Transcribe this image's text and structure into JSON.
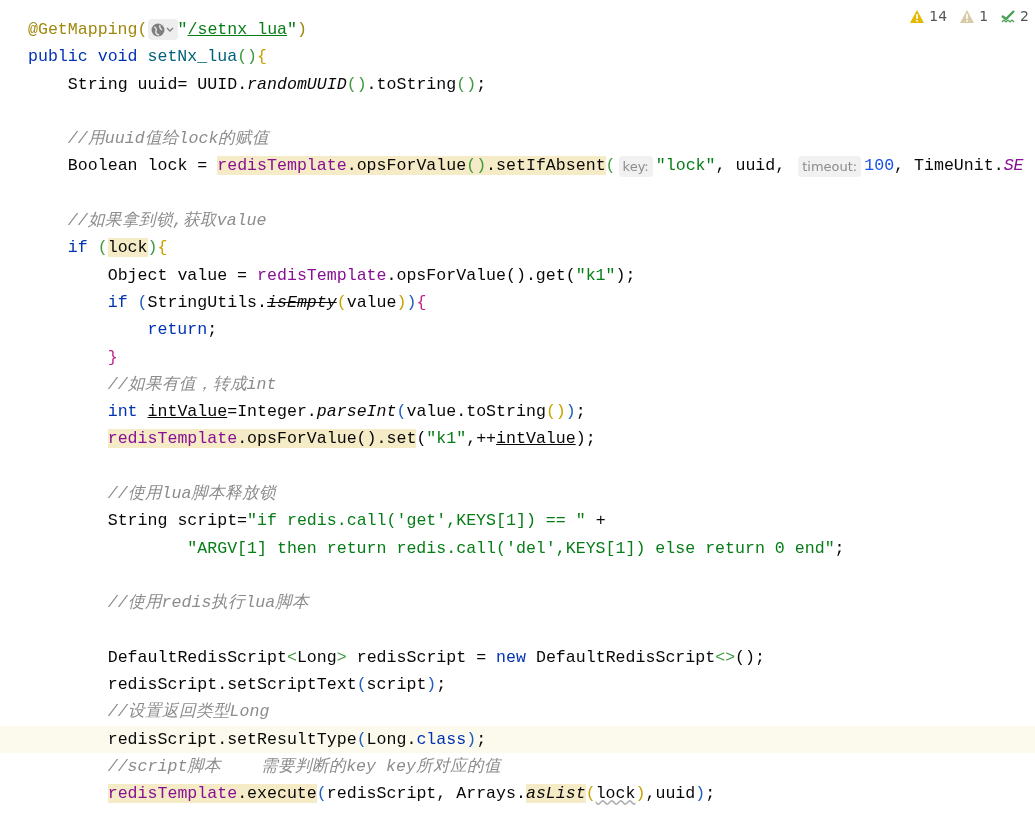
{
  "inspections": [
    {
      "kind": "warning",
      "count": "14"
    },
    {
      "kind": "weak_warning",
      "count": "1"
    },
    {
      "kind": "typo",
      "count": "2"
    }
  ],
  "lines": [
    {
      "current": false,
      "segments": [
        {
          "kind": "code",
          "tokens": [
            {
              "text": "@GetMapping(",
              "kind": "ann"
            }
          ]
        },
        {
          "kind": "icon"
        },
        {
          "kind": "code",
          "tokens": [
            {
              "text": "\"",
              "kind": "str"
            },
            {
              "text": "/setnx_lua",
              "kind": "str",
              "underlined": true
            },
            {
              "text": "\"",
              "kind": "str"
            },
            {
              "text": ")",
              "kind": "ann"
            }
          ]
        }
      ]
    },
    {
      "current": false,
      "segments": [
        {
          "kind": "code",
          "tokens": [
            {
              "text": "public void ",
              "kind": "kw"
            },
            {
              "text": "setNx_lua",
              "kind": "decl"
            },
            {
              "text": "()",
              "kind": "g"
            },
            {
              "text": "{",
              "kind": "y"
            }
          ]
        }
      ]
    },
    {
      "current": false,
      "segments": [
        {
          "kind": "code",
          "tokens": [
            {
              "text": "    String uuid= UUID.",
              "kind": "t"
            },
            {
              "text": "randomUUID",
              "kind": "it"
            },
            {
              "text": "()",
              "kind": "g"
            },
            {
              "text": ".toString",
              "kind": "t"
            },
            {
              "text": "()",
              "kind": "g"
            },
            {
              "text": ";",
              "kind": "t"
            }
          ]
        }
      ]
    },
    {
      "current": false
    },
    {
      "current": false,
      "segments": [
        {
          "kind": "code",
          "tokens": [
            {
              "text": "    //用uuid值给lock的赋值",
              "kind": "cm"
            }
          ]
        }
      ]
    },
    {
      "current": false,
      "segments": [
        {
          "kind": "code",
          "tokens": [
            {
              "text": "    Boolean lock = ",
              "kind": "t"
            },
            {
              "text": "redisTemplate",
              "kind": "fld",
              "highlighted": true
            },
            {
              "text": ".opsForValue",
              "kind": "t",
              "highlighted": true
            },
            {
              "text": "()",
              "kind": "g",
              "highlighted": true
            },
            {
              "text": ".setIfAbsent",
              "kind": "t",
              "highlighted": true
            },
            {
              "text": "(",
              "kind": "g"
            }
          ]
        },
        {
          "kind": "hint",
          "text": "key:"
        },
        {
          "kind": "code",
          "tokens": [
            {
              "text": "\"lock\"",
              "kind": "str"
            },
            {
              "text": ", uuid, ",
              "kind": "t"
            }
          ]
        },
        {
          "kind": "hint",
          "text": "timeout:"
        },
        {
          "kind": "code",
          "tokens": [
            {
              "text": "100",
              "kind": "num"
            },
            {
              "text": ", TimeUnit.",
              "kind": "t"
            },
            {
              "text": "SE",
              "kind": "sfld"
            }
          ]
        }
      ]
    },
    {
      "current": false
    },
    {
      "current": false,
      "segments": [
        {
          "kind": "code",
          "tokens": [
            {
              "text": "    //如果拿到锁,获取value",
              "kind": "cm"
            }
          ]
        }
      ]
    },
    {
      "current": false,
      "segments": [
        {
          "kind": "code",
          "tokens": [
            {
              "text": "    if ",
              "kind": "kw"
            },
            {
              "text": "(",
              "kind": "g"
            },
            {
              "text": "lock",
              "kind": "t",
              "highlighted": true
            },
            {
              "text": ")",
              "kind": "g"
            },
            {
              "text": "{",
              "kind": "y"
            }
          ]
        }
      ]
    },
    {
      "current": false,
      "segments": [
        {
          "kind": "code",
          "tokens": [
            {
              "text": "        Object value = ",
              "kind": "t"
            },
            {
              "text": "redisTemplate",
              "kind": "fld"
            },
            {
              "text": ".opsForValue().get(",
              "kind": "t"
            },
            {
              "text": "\"k1\"",
              "kind": "str"
            },
            {
              "text": ");",
              "kind": "t"
            }
          ]
        }
      ]
    },
    {
      "current": false,
      "segments": [
        {
          "kind": "code",
          "tokens": [
            {
              "text": "        if ",
              "kind": "kw"
            },
            {
              "text": "(",
              "kind": "b"
            },
            {
              "text": "StringUtils.",
              "kind": "t"
            },
            {
              "text": "isEmpty",
              "kind": "it",
              "struck": true
            },
            {
              "text": "(",
              "kind": "y"
            },
            {
              "text": "value",
              "kind": "t"
            },
            {
              "text": ")",
              "kind": "y"
            },
            {
              "text": ")",
              "kind": "b"
            },
            {
              "text": "{",
              "kind": "m"
            }
          ]
        }
      ]
    },
    {
      "current": false,
      "segments": [
        {
          "kind": "code",
          "tokens": [
            {
              "text": "            return",
              "kind": "kw"
            },
            {
              "text": ";",
              "kind": "t"
            }
          ]
        }
      ]
    },
    {
      "current": false,
      "segments": [
        {
          "kind": "code",
          "tokens": [
            {
              "text": "        }",
              "kind": "m"
            }
          ]
        }
      ]
    },
    {
      "current": false,
      "segments": [
        {
          "kind": "code",
          "tokens": [
            {
              "text": "        //如果有值，转成int",
              "kind": "cm"
            }
          ]
        }
      ]
    },
    {
      "current": false,
      "segments": [
        {
          "kind": "code",
          "tokens": [
            {
              "text": "        int ",
              "kind": "kw"
            },
            {
              "text": "intValue",
              "kind": "t",
              "underlined": true
            },
            {
              "text": "=Integer.",
              "kind": "t"
            },
            {
              "text": "parseInt",
              "kind": "it"
            },
            {
              "text": "(",
              "kind": "b"
            },
            {
              "text": "value.toString",
              "kind": "t"
            },
            {
              "text": "()",
              "kind": "y"
            },
            {
              "text": ")",
              "kind": "b"
            },
            {
              "text": ";",
              "kind": "t"
            }
          ]
        }
      ]
    },
    {
      "current": false,
      "segments": [
        {
          "kind": "code",
          "tokens": [
            {
              "text": "        redisTemplate",
              "kind": "fld",
              "highlighted": true
            },
            {
              "text": ".opsForValue().set",
              "kind": "t",
              "highlighted": true
            },
            {
              "text": "(",
              "kind": "t"
            },
            {
              "text": "\"k1\"",
              "kind": "str"
            },
            {
              "text": ",++",
              "kind": "t"
            },
            {
              "text": "intValue",
              "kind": "t",
              "underlined": true
            },
            {
              "text": ");",
              "kind": "t"
            }
          ]
        }
      ]
    },
    {
      "current": false
    },
    {
      "current": false,
      "segments": [
        {
          "kind": "code",
          "tokens": [
            {
              "text": "        //使用lua脚本释放锁",
              "kind": "cm"
            }
          ]
        }
      ]
    },
    {
      "current": false,
      "segments": [
        {
          "kind": "code",
          "tokens": [
            {
              "text": "        String script=",
              "kind": "t"
            },
            {
              "text": "\"if redis.call('get',KEYS[1]) == \"",
              "kind": "str"
            },
            {
              "text": " +",
              "kind": "t"
            }
          ]
        }
      ]
    },
    {
      "current": false,
      "segments": [
        {
          "kind": "code",
          "tokens": [
            {
              "text": "                \"ARGV[1] then return redis.call('del',KEYS[1]) else return 0 end\"",
              "kind": "str"
            },
            {
              "text": ";",
              "kind": "t"
            }
          ]
        }
      ]
    },
    {
      "current": false
    },
    {
      "current": false,
      "segments": [
        {
          "kind": "code",
          "tokens": [
            {
              "text": "        //使用redis执行lua脚本",
              "kind": "cm"
            }
          ]
        }
      ]
    },
    {
      "current": false
    },
    {
      "current": false,
      "segments": [
        {
          "kind": "code",
          "tokens": [
            {
              "text": "        DefaultRedisScript",
              "kind": "t"
            },
            {
              "text": "<",
              "kind": "g"
            },
            {
              "text": "Long",
              "kind": "t"
            },
            {
              "text": ">",
              "kind": "g"
            },
            {
              "text": " redisScript = ",
              "kind": "t"
            },
            {
              "text": "new ",
              "kind": "kw"
            },
            {
              "text": "DefaultRedisScript",
              "kind": "t"
            },
            {
              "text": "<>",
              "kind": "g"
            },
            {
              "text": "();",
              "kind": "t"
            }
          ]
        }
      ]
    },
    {
      "current": false,
      "segments": [
        {
          "kind": "code",
          "tokens": [
            {
              "text": "        redisScript.setScriptText",
              "kind": "t"
            },
            {
              "text": "(",
              "kind": "b"
            },
            {
              "text": "script",
              "kind": "t"
            },
            {
              "text": ")",
              "kind": "b"
            },
            {
              "text": ";",
              "kind": "t"
            }
          ]
        }
      ]
    },
    {
      "current": false,
      "segments": [
        {
          "kind": "code",
          "tokens": [
            {
              "text": "        //设置返回类型Long",
              "kind": "cm"
            }
          ]
        }
      ]
    },
    {
      "current": true,
      "segments": [
        {
          "kind": "code",
          "tokens": [
            {
              "text": "        redisScript.setResultType",
              "kind": "t"
            },
            {
              "text": "(",
              "kind": "b"
            },
            {
              "text": "Long.",
              "kind": "t"
            },
            {
              "text": "class",
              "kind": "kw"
            },
            {
              "text": ")",
              "kind": "b"
            },
            {
              "text": ";",
              "kind": "t"
            }
          ]
        }
      ]
    },
    {
      "current": false,
      "segments": [
        {
          "kind": "code",
          "tokens": [
            {
              "text": "        //script脚本    需要判断的key key所对应的值",
              "kind": "cm"
            }
          ]
        }
      ]
    },
    {
      "current": false,
      "segments": [
        {
          "kind": "code",
          "tokens": [
            {
              "text": "        redisTemplate",
              "kind": "fld",
              "highlighted": true
            },
            {
              "text": ".execute",
              "kind": "t",
              "highlighted": true
            },
            {
              "text": "(",
              "kind": "b"
            },
            {
              "text": "redisScript, Arrays.",
              "kind": "t"
            },
            {
              "text": "asList",
              "kind": "it",
              "highlighted": true
            },
            {
              "text": "(",
              "kind": "y"
            },
            {
              "text": "lock",
              "kind": "t",
              "squiggly": true
            },
            {
              "text": ")",
              "kind": "y"
            },
            {
              "text": ",uuid",
              "kind": "t"
            },
            {
              "text": ")",
              "kind": "b"
            },
            {
              "text": ";",
              "kind": "t"
            }
          ]
        }
      ]
    }
  ]
}
